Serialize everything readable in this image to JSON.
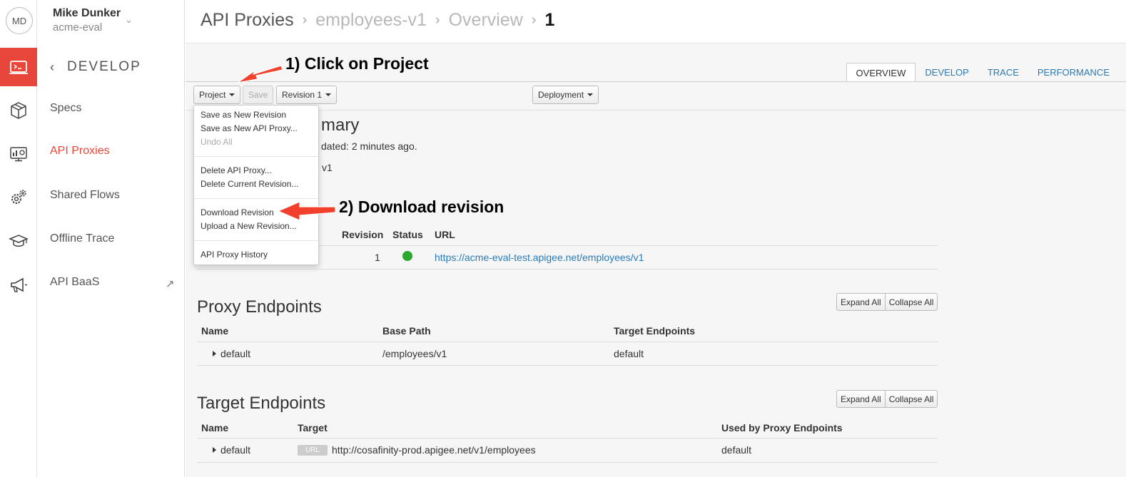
{
  "user": {
    "initials": "MD",
    "name": "Mike Dunker",
    "org": "acme-eval"
  },
  "rail": {
    "items": [
      {
        "icon": "terminal-icon",
        "active": true
      },
      {
        "icon": "package-icon",
        "active": false
      },
      {
        "icon": "dashboard-icon",
        "active": false
      },
      {
        "icon": "gears-icon",
        "active": false
      },
      {
        "icon": "graduation-cap-icon",
        "active": false
      },
      {
        "icon": "megaphone-icon",
        "active": false
      }
    ]
  },
  "nav": {
    "section": "DEVELOP",
    "items": [
      {
        "label": "Specs"
      },
      {
        "label": "API Proxies",
        "active": true
      },
      {
        "label": "Shared Flows"
      },
      {
        "label": "Offline Trace"
      },
      {
        "label": "API BaaS",
        "external": true
      }
    ]
  },
  "breadcrumb": {
    "root": "API Proxies",
    "proxy": "employees-v1",
    "page": "Overview",
    "revision": "1"
  },
  "tabs": [
    "OVERVIEW",
    "DEVELOP",
    "TRACE",
    "PERFORMANCE"
  ],
  "toolbar": {
    "project": "Project",
    "save": "Save",
    "revision": "Revision 1",
    "deployment": "Deployment"
  },
  "annotations": {
    "step1": "1) Click on Project",
    "step2": "2) Download revision"
  },
  "project_menu": {
    "groups": [
      [
        {
          "label": "Save as New Revision"
        },
        {
          "label": "Save as New API Proxy..."
        },
        {
          "label": "Undo All",
          "disabled": true
        }
      ],
      [
        {
          "label": "Delete API Proxy..."
        },
        {
          "label": "Delete Current Revision..."
        }
      ],
      [
        {
          "label": "Download Revision"
        },
        {
          "label": "Upload a New Revision..."
        }
      ],
      [
        {
          "label": "API Proxy History"
        }
      ]
    ]
  },
  "summary": {
    "title_fragment": "mary",
    "updated_fragment": "dated: 2 minutes ago.",
    "base_fragment": "v1"
  },
  "deployments": {
    "headers": [
      "Revision",
      "Status",
      "URL"
    ],
    "rows": [
      {
        "revision": "1",
        "status": "deployed",
        "url": "https://acme-eval-test.apigee.net/employees/v1"
      }
    ],
    "status_color": "#2aa830"
  },
  "proxy_endpoints": {
    "title": "Proxy Endpoints",
    "expand": "Expand All",
    "collapse": "Collapse All",
    "headers": [
      "Name",
      "Base Path",
      "Target Endpoints"
    ],
    "rows": [
      {
        "name": "default",
        "base_path": "/employees/v1",
        "target": "default"
      }
    ]
  },
  "target_endpoints": {
    "title": "Target Endpoints",
    "expand": "Expand All",
    "collapse": "Collapse All",
    "headers": [
      "Name",
      "Target",
      "Used by Proxy Endpoints"
    ],
    "rows": [
      {
        "name": "default",
        "badge": "URL",
        "target": "http://cosafinity-prod.apigee.net/v1/employees",
        "used_by": "default"
      }
    ]
  },
  "colors": {
    "accent": "#e8463a",
    "link": "#2a7ab8",
    "annotation_arrow": "#f2402c"
  }
}
